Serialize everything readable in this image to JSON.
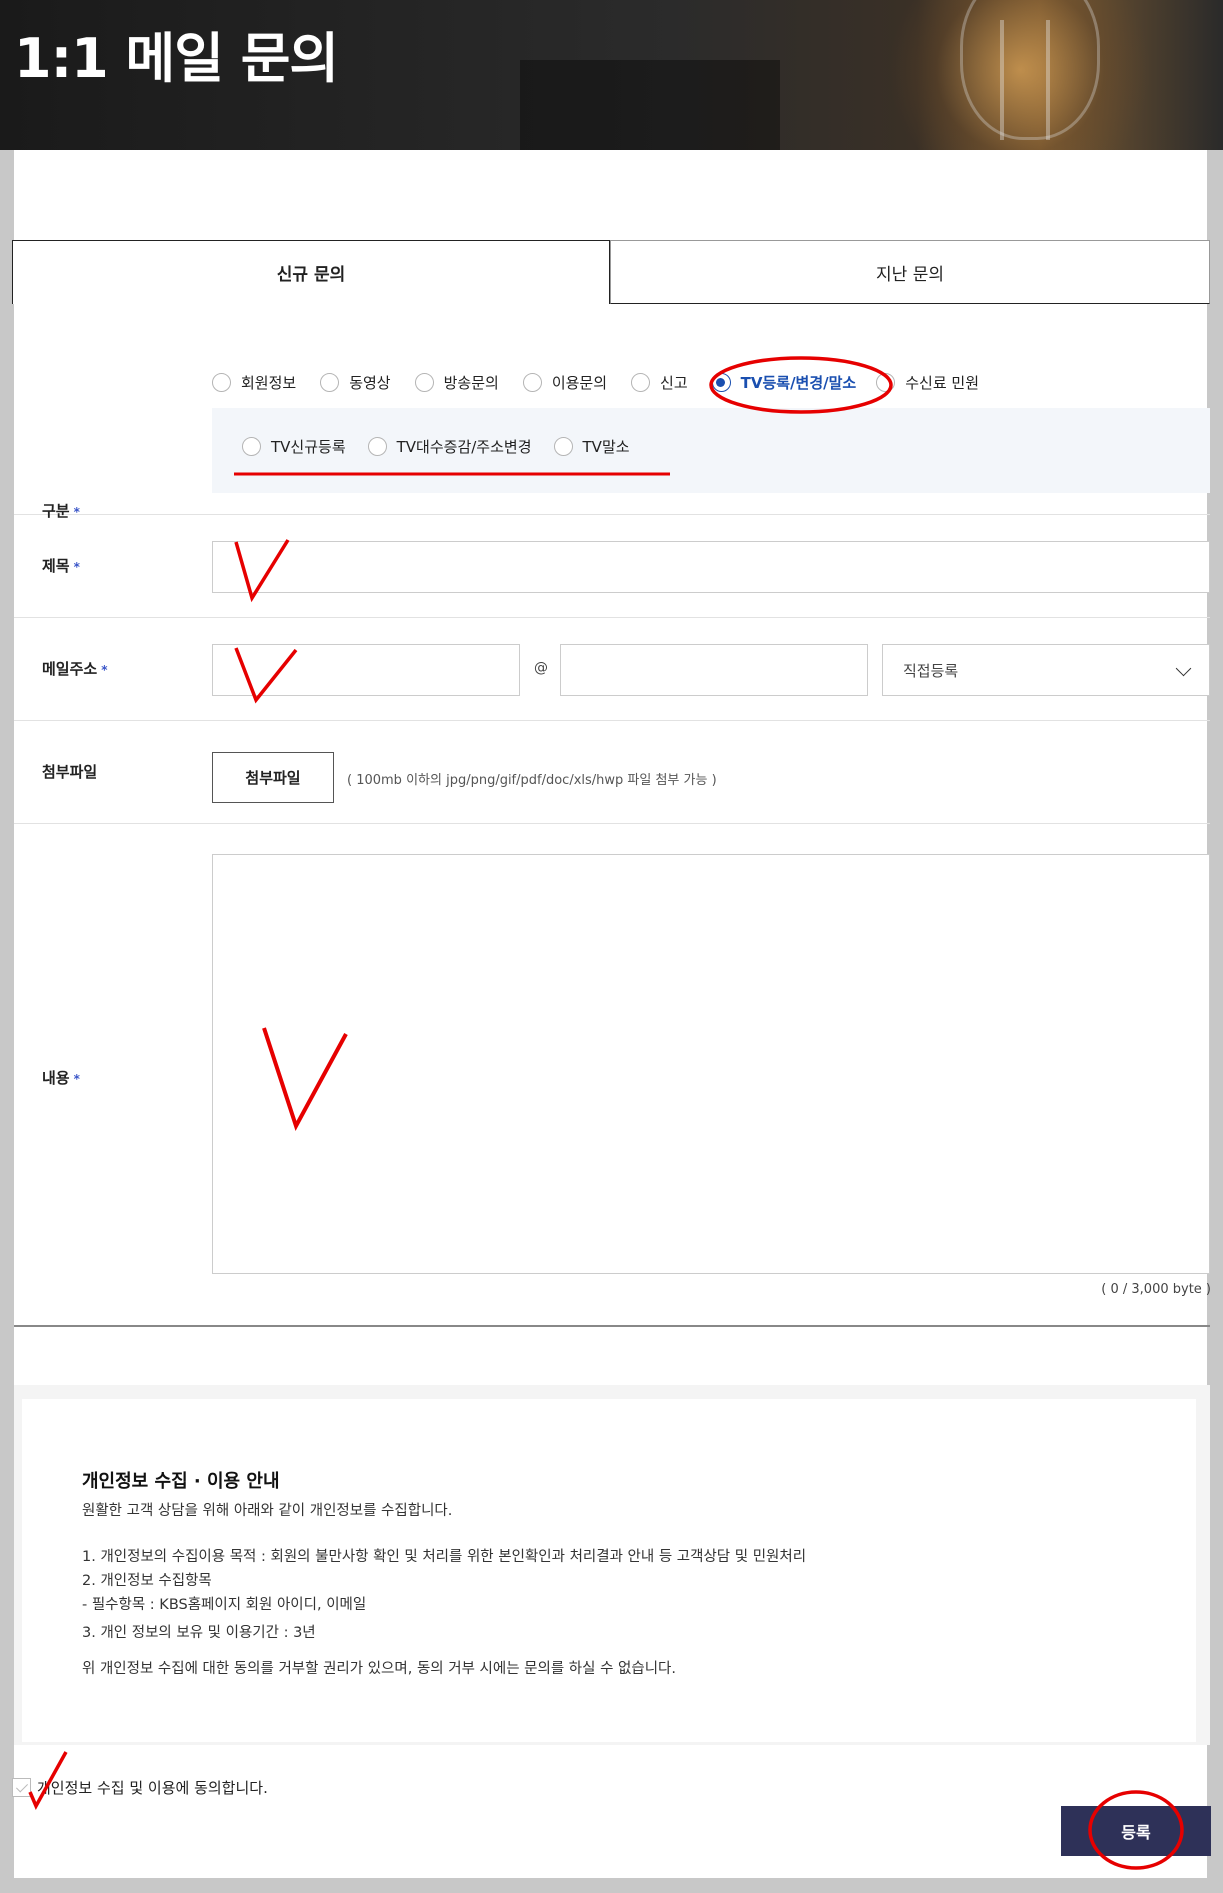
{
  "banner": {
    "title": "1:1 메일 문의"
  },
  "tabs": [
    {
      "label": "신규 문의",
      "active": true
    },
    {
      "label": "지난 문의",
      "active": false
    }
  ],
  "category": {
    "label": "구분",
    "required_mark": "*",
    "options": [
      "회원정보",
      "동영상",
      "방송문의",
      "이용문의",
      "신고",
      "TV등록/변경/말소",
      "수신료 민원"
    ],
    "selected": "TV등록/변경/말소",
    "sub_options": [
      "TV신규등록",
      "TV대수증감/주소변경",
      "TV말소"
    ]
  },
  "subject": {
    "label": "제목",
    "required_mark": "*",
    "value": ""
  },
  "email": {
    "label": "메일주소",
    "required_mark": "*",
    "local_value": "",
    "at": "@",
    "domain_value": "",
    "domain_select": "직접등록"
  },
  "attachment": {
    "label": "첨부파일",
    "button": "첨부파일",
    "help": "( 100mb 이하의 jpg/png/gif/pdf/doc/xls/hwp 파일 첨부 가능 )"
  },
  "content": {
    "label": "내용",
    "required_mark": "*",
    "value": "",
    "byte_count": "( 0 / 3,000 byte )"
  },
  "privacy": {
    "title": "개인정보 수집 · 이용 안내",
    "intro": "원활한 고객 상담을 위해 아래와 같이 개인정보를 수집합니다.",
    "item1": "1. 개인정보의 수집이용 목적 : 회원의 불만사항 확인 및 처리를 위한 본인확인과 처리결과 안내 등 고객상담 및 민원처리",
    "item2": "2. 개인정보 수집항목",
    "item2_sub": " - 필수항목 : KBS홈페이지 회원 아이디, 이메일",
    "item3": "3. 개인 정보의 보유 및 이용기간 : 3년",
    "notice": "위 개인정보 수집에 대한 동의를 거부할 권리가 있으며, 동의 거부 시에는 문의를 하실 수 없습니다."
  },
  "agree": {
    "label": "개인정보 수집 및 이용에 동의합니다.",
    "checked": false
  },
  "submit": {
    "label": "등록"
  },
  "colors": {
    "accent": "#1a4fb0",
    "submit_bg": "#2e3158",
    "annotation": "#e60000"
  }
}
